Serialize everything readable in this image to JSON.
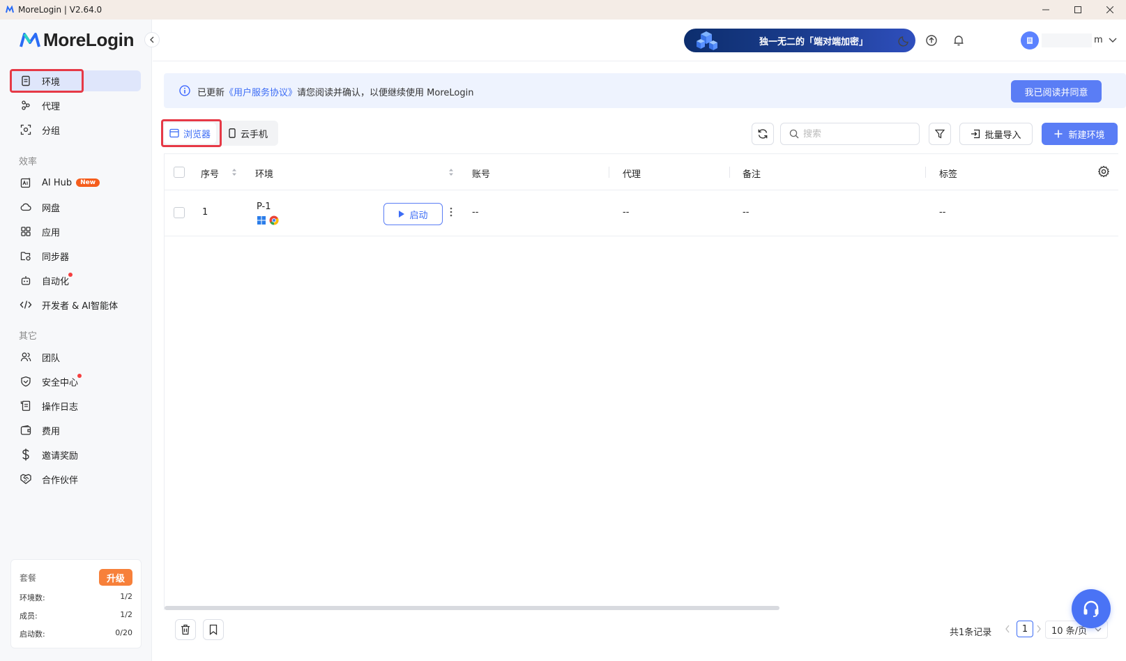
{
  "window": {
    "title": "MoreLogin | V2.64.0"
  },
  "sidebar": {
    "logo_text": "MoreLogin",
    "items": [
      {
        "label": "环境",
        "icon": "document-icon",
        "active": true
      },
      {
        "label": "代理",
        "icon": "proxy-icon"
      },
      {
        "label": "分组",
        "icon": "group-icon"
      }
    ],
    "section_efficiency": "效率",
    "efficiency_items": [
      {
        "label": "AI Hub",
        "badge": "New",
        "icon": "ai-hub-icon"
      },
      {
        "label": "网盘",
        "icon": "cloud-icon"
      },
      {
        "label": "应用",
        "icon": "apps-icon"
      },
      {
        "label": "同步器",
        "icon": "sync-icon"
      },
      {
        "label": "自动化",
        "icon": "robot-icon",
        "dot": true
      },
      {
        "label": "开发者 & AI智能体",
        "icon": "code-icon"
      }
    ],
    "section_other": "其它",
    "other_items": [
      {
        "label": "团队",
        "icon": "team-icon"
      },
      {
        "label": "安全中心",
        "icon": "shield-icon",
        "dot": true
      },
      {
        "label": "操作日志",
        "icon": "log-icon"
      },
      {
        "label": "费用",
        "icon": "wallet-icon"
      },
      {
        "label": "邀请奖励",
        "icon": "dollar-icon"
      },
      {
        "label": "合作伙伴",
        "icon": "handshake-icon"
      }
    ],
    "plan": {
      "title": "套餐",
      "upgrade_label": "升级",
      "rows": [
        {
          "label": "环境数:",
          "value": "1/2"
        },
        {
          "label": "成员:",
          "value": "1/2"
        },
        {
          "label": "启动数:",
          "value": "0/20"
        }
      ]
    }
  },
  "header": {
    "banner_text": "独一无二的「端对端加密」",
    "username": "m"
  },
  "notice": {
    "prefix": "已更新",
    "link": "《用户服务协议》",
    "suffix": "请您阅读并确认，以便继续使用 MoreLogin",
    "button": "我已阅读并同意"
  },
  "tabs": {
    "browser": "浏览器",
    "cloud_phone": "云手机"
  },
  "toolbar": {
    "search_placeholder": "搜索",
    "import_label": "批量导入",
    "create_label": "新建环境"
  },
  "table": {
    "columns": [
      "序号",
      "环境",
      "账号",
      "代理",
      "备注",
      "标签"
    ],
    "rows": [
      {
        "index": "1",
        "env": "P-1",
        "account": "--",
        "proxy": "--",
        "note": "--",
        "tag": "--",
        "action": "启动"
      }
    ]
  },
  "footer": {
    "total": "共1条记录",
    "current_page": "1",
    "page_size": "10 条/页"
  },
  "colors": {
    "accent": "#3c6cf5",
    "primary_button": "#5a7df5",
    "highlight_box": "#e63946",
    "upgrade": "#f7803a",
    "badge": "#f55d1c"
  }
}
